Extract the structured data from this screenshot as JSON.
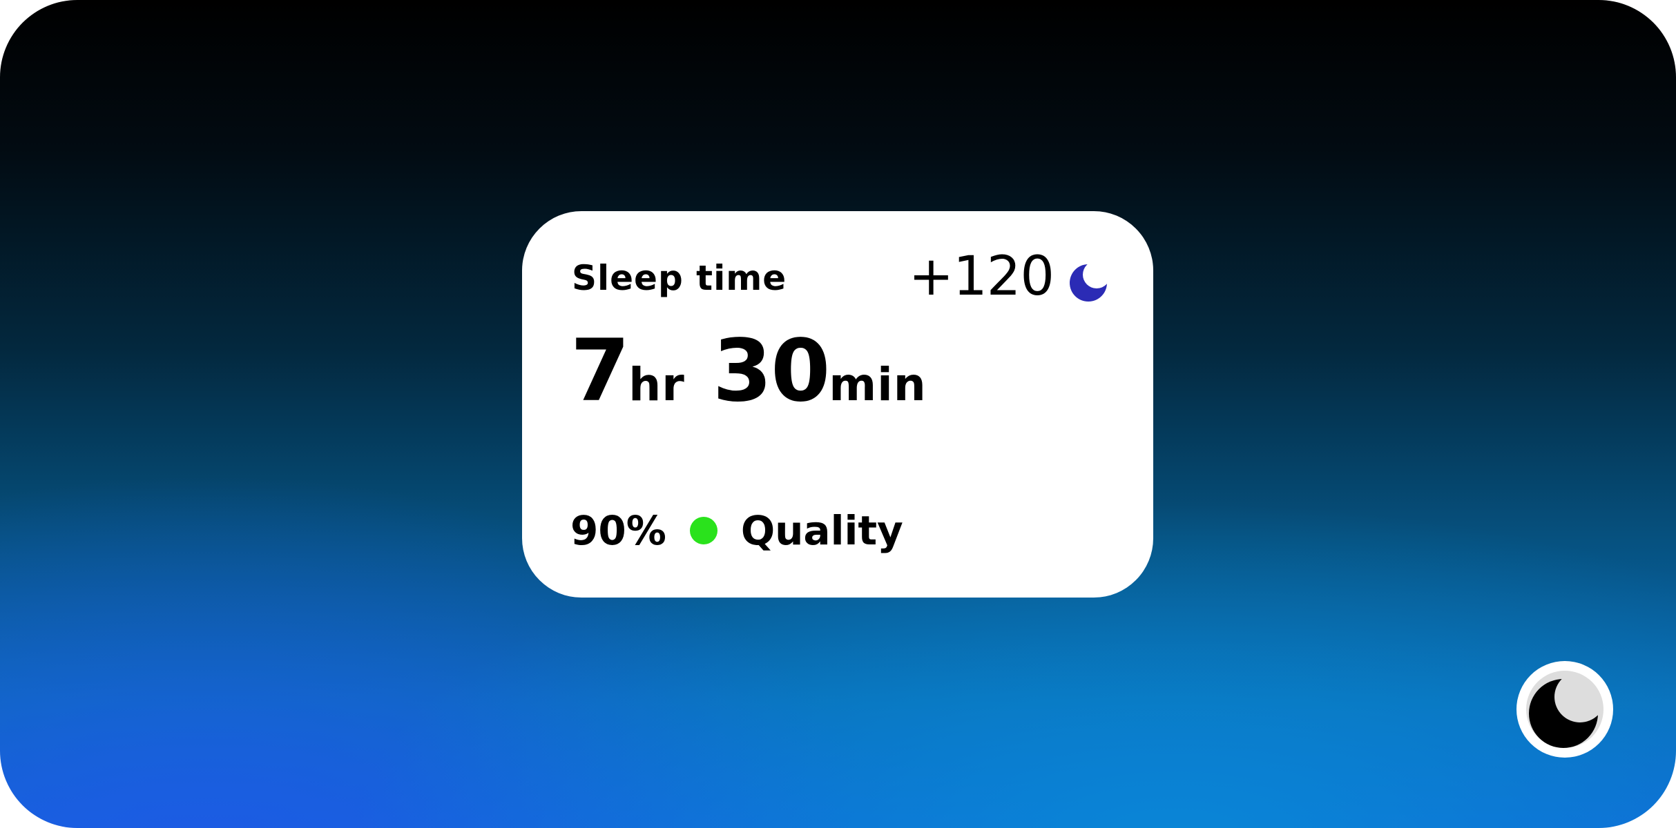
{
  "widget": {
    "title": "Sleep time",
    "delta": "+120",
    "moon_icon": "moon-icon",
    "moon_color": "#2b2bb5",
    "hours_value": "7",
    "hours_unit": "hr",
    "minutes_value": "30",
    "minutes_unit": "min",
    "quality_percent": "90%",
    "quality_dot_color": "#2ae21c",
    "quality_label": "Quality"
  },
  "theme_toggle": {
    "icon": "dark-mode-toggle-icon"
  }
}
